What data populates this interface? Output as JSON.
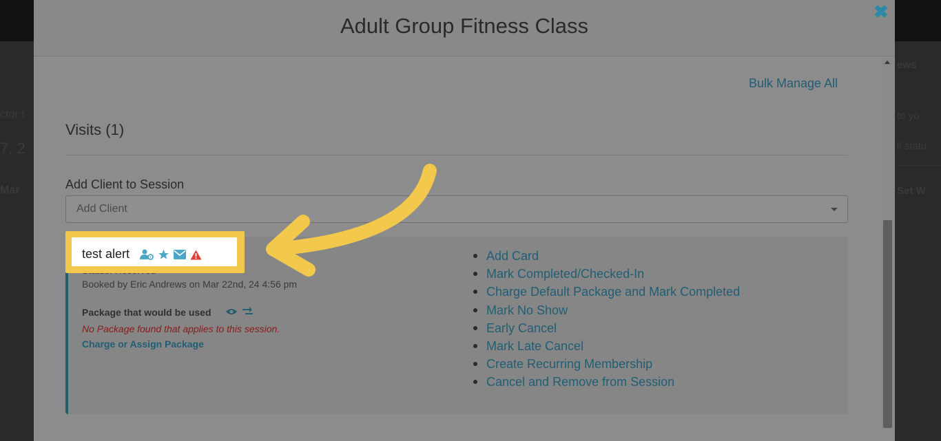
{
  "background": {
    "left_texts": [
      "ctor t",
      "7, 2",
      "Mar"
    ],
    "right_texts": [
      "ews",
      "to yo",
      "ll statu",
      "Set W"
    ]
  },
  "modal": {
    "title": "Adult Group Fitness Class",
    "bulk_manage_label": "Bulk Manage All",
    "visits_heading": "Visits (1)",
    "add_client_label": "Add Client to Session",
    "add_client_placeholder": "Add Client"
  },
  "client": {
    "name": "test alert",
    "status_text": "Status: Reserved",
    "booked_text": "Booked by Eric Andrews on Mar 22nd, 24 4:56 pm",
    "package_label": "Package that would be used",
    "no_package_text": "No Package found that applies to this session.",
    "charge_link": "Charge or Assign Package",
    "icons": [
      "user-gear-icon",
      "star-icon",
      "envelope-icon",
      "alert-triangle-icon"
    ]
  },
  "actions": [
    "Add Card",
    "Mark Completed/Checked-In",
    "Charge Default Package and Mark Completed",
    "Mark No Show",
    "Early Cancel",
    "Mark Late Cancel",
    "Create Recurring Membership",
    "Cancel and Remove from Session"
  ],
  "colors": {
    "accent": "#2d8aa6",
    "highlight": "#f2c94c",
    "alert": "#e53935"
  }
}
